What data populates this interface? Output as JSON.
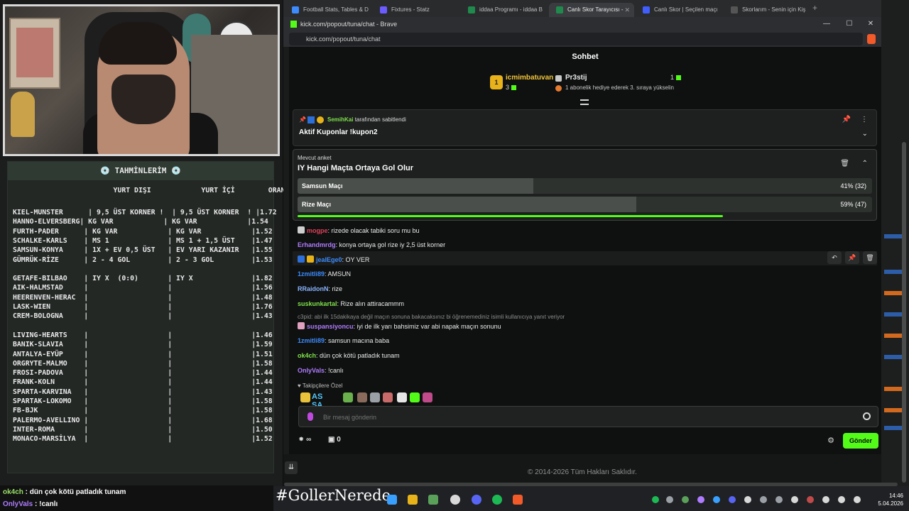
{
  "predictions": {
    "title": "💿 TAHMİNLERİM 💿",
    "header": "                        YURT DIŞI            YURT İÇİ        ORAN",
    "rows": [
      "KIEL-MUNSTER      | 9,5 ÜST KORNER !  | 9,5 ÜST KORNER  ! |1.72",
      "HANNO-ELVERSBERG| KG VAR            | KG VAR            |1.54",
      "FURTH-PADER      | KG VAR            | KG VAR            |1.52",
      "SCHALKE-KARLS    | MS 1              | MS 1 + 1,5 ÜST    |1.47",
      "SAMSUN-KONYA     | 1X + EV 0,5 ÜST   | EV YARI KAZANIR   |1.55",
      "GÜMRÜK-RİZE      | 2 - 4 GOL         | 2 - 3 GOL         |1.53",
      "",
      "GETAFE-BILBAO    | IY X  (0:0)       | IY X              |1.82",
      "AIK-HALMSTAD     |                   |                   |1.56",
      "HEERENVEN-HERAC  |                   |                   |1.48",
      "LASK-WIEN        |                   |                   |1.76",
      "CREM-BOLOGNA     |                   |                   |1.43",
      "",
      "LIVING-HEARTS    |                   |                   |1.46",
      "BANIK-SLAVIA     |                   |                   |1.59",
      "ANTALYA-EYÜP     |                   |                   |1.51",
      "ORGRYTE-MALMO    |                   |                   |1.58",
      "FROSI-PADOVA     |                   |                   |1.44",
      "FRANK-KOLN       |                   |                   |1.44",
      "SPARTA-KARVINA   |                   |                   |1.43",
      "SPARTAK-LOKOMO   |                   |                   |1.58",
      "FB-BJK           |                   |                   |1.58",
      "PALERMO-AVELLINO |                   |                   |1.68",
      "INTER-ROMA       |                   |                   |1.50",
      "MONACO-MARSİLYA  |                   |                   |1.52"
    ]
  },
  "overlay_chat": [
    {
      "name": "ok4ch",
      "text": " : dün çok kötü patladık tunam"
    },
    {
      "name": "OnlyVals",
      "text": " : !canlı"
    }
  ],
  "browser": {
    "tabs": [
      {
        "label": "Football Stats, Tables & D",
        "color": "#3d8bfd"
      },
      {
        "label": "Fixtures - Statz",
        "color": "#6a5cff"
      },
      {
        "label": "iddaa Programı - iddaa B",
        "color": "#1f8a4c"
      },
      {
        "label": "Canlı Skor Tarayıcısı -",
        "color": "#1f8a4c"
      },
      {
        "label": "Canlı Skor | Seçilen maçı",
        "color": "#3f5efb"
      },
      {
        "label": "Skorlarım - Senin için Kiş",
        "color": "#333333"
      }
    ],
    "popup_title": "kick.com/popout/tuna/chat - Brave",
    "url": "kick.com/popout/tuna/chat"
  },
  "chat": {
    "header": "Sohbet",
    "leaderboard": {
      "first_rank": "1",
      "first_user": "icmimbatuvan",
      "first_count": "3",
      "second_user": "Pr3stij",
      "second_count": "1",
      "promo": "1 abonelik hediye ederek 3. sıraya yükselin"
    },
    "pinned": {
      "by_name": "SemihKai",
      "by_suffix": " tarafından sabitlendi",
      "text": "Aktif Kuponlar !kupon2"
    },
    "poll": {
      "label": "Mevcut anket",
      "question": "IY Hangi Maçta Ortaya Gol Olur",
      "options": [
        {
          "label": "Samsun Maçı",
          "result": "41% (32)",
          "percent": 41
        },
        {
          "label": "Rize Maçı",
          "result": "59% (47)",
          "percent": 59
        }
      ],
      "remaining": 0.74
    },
    "messages": [
      {
        "name": "mogpe",
        "color": "#e0405a",
        "text": ": rizede olacak tabiki soru mu bu"
      },
      {
        "name": "Erhandmrdg",
        "color": "#b07cff",
        "text": ": konya ortaya gol rize iy 2,5 üst korner"
      },
      {
        "name": "jealEge0",
        "color": "#3d8bfd",
        "text": ": OY VER"
      },
      {
        "name": "1zmitli89",
        "color": "#3d8bfd",
        "text": ": AMSUN"
      },
      {
        "name": "RRaidonN",
        "color": "#8ab4ff",
        "text": ": rize"
      },
      {
        "name": "suskunkartal",
        "color": "#7ee04b",
        "text": ": Rize alın attiracammm"
      },
      {
        "name": "suspansiyoncu",
        "color": "#b07cff",
        "text": ": iyi de ilk yarı bahsimiz var abi napak maçın sonunu"
      },
      {
        "name": "1zmitli89",
        "color": "#3d8bfd",
        "text": ": samsun macına baba"
      },
      {
        "name": "ok4ch",
        "color": "#7ee04b",
        "text": ": dün çok kötü patladık tunam"
      },
      {
        "name": "OnlyVals",
        "color": "#b07cff",
        "text": ": !canlı"
      }
    ],
    "reply_hint": "c3pid: abi ilk 15dakikaya değil maçın sonuna bakacaksınız bi öğrenemediniz isimli kullanıcıya yanıt veriyor",
    "followers_label": "♥ Takipçilere Özel",
    "emote_text": "AS SA",
    "input_placeholder": "Bir mesaj gönderin",
    "foot_infinity": "∞",
    "foot_count": "0",
    "send_label": "Gönder"
  },
  "below": {
    "copyright": "© 2014-2026 Tüm Hakları Saklıdır."
  },
  "taskbar": {
    "hashtag": "#GollerNerede",
    "time": "14:46",
    "date": "5.04.2026"
  }
}
